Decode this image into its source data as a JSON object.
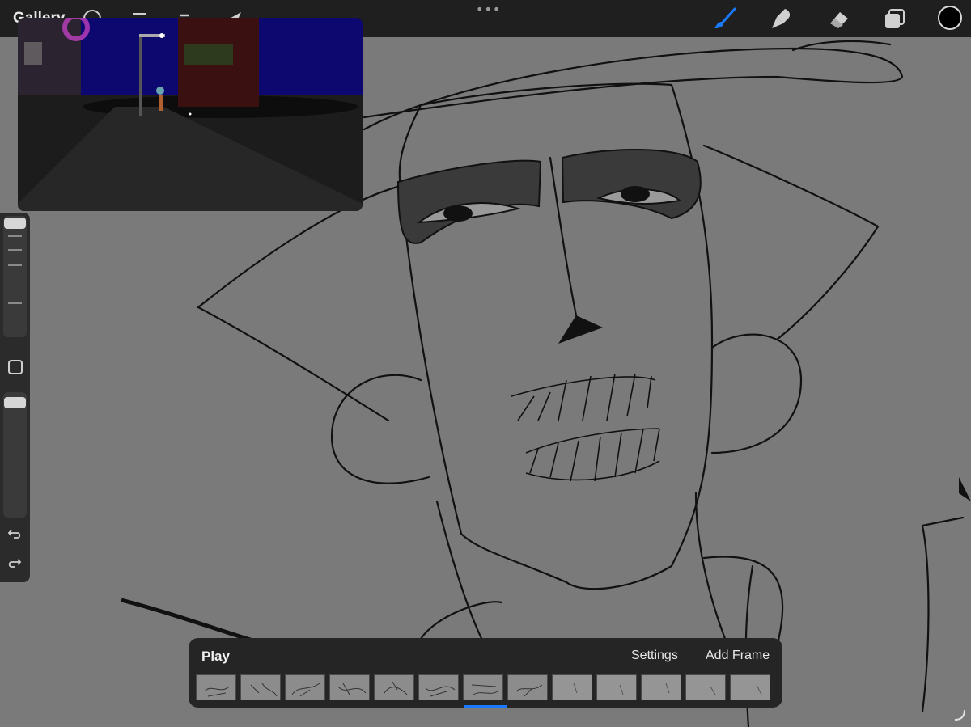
{
  "app": {
    "gallery_label": "Gallery"
  },
  "toolbar": {
    "left_tools": [
      "adjustments-icon",
      "selection-icon",
      "transform-icon",
      "pointer-icon"
    ],
    "right_tools": [
      "brush-icon",
      "smudge-icon",
      "eraser-icon",
      "layers-icon"
    ],
    "active_tool": "brush-icon",
    "accent_color": "#1a7aff",
    "current_color": "#000000"
  },
  "animation": {
    "play_label": "Play",
    "settings_label": "Settings",
    "add_frame_label": "Add Frame",
    "frame_count": 13,
    "selected_frame": 7
  }
}
